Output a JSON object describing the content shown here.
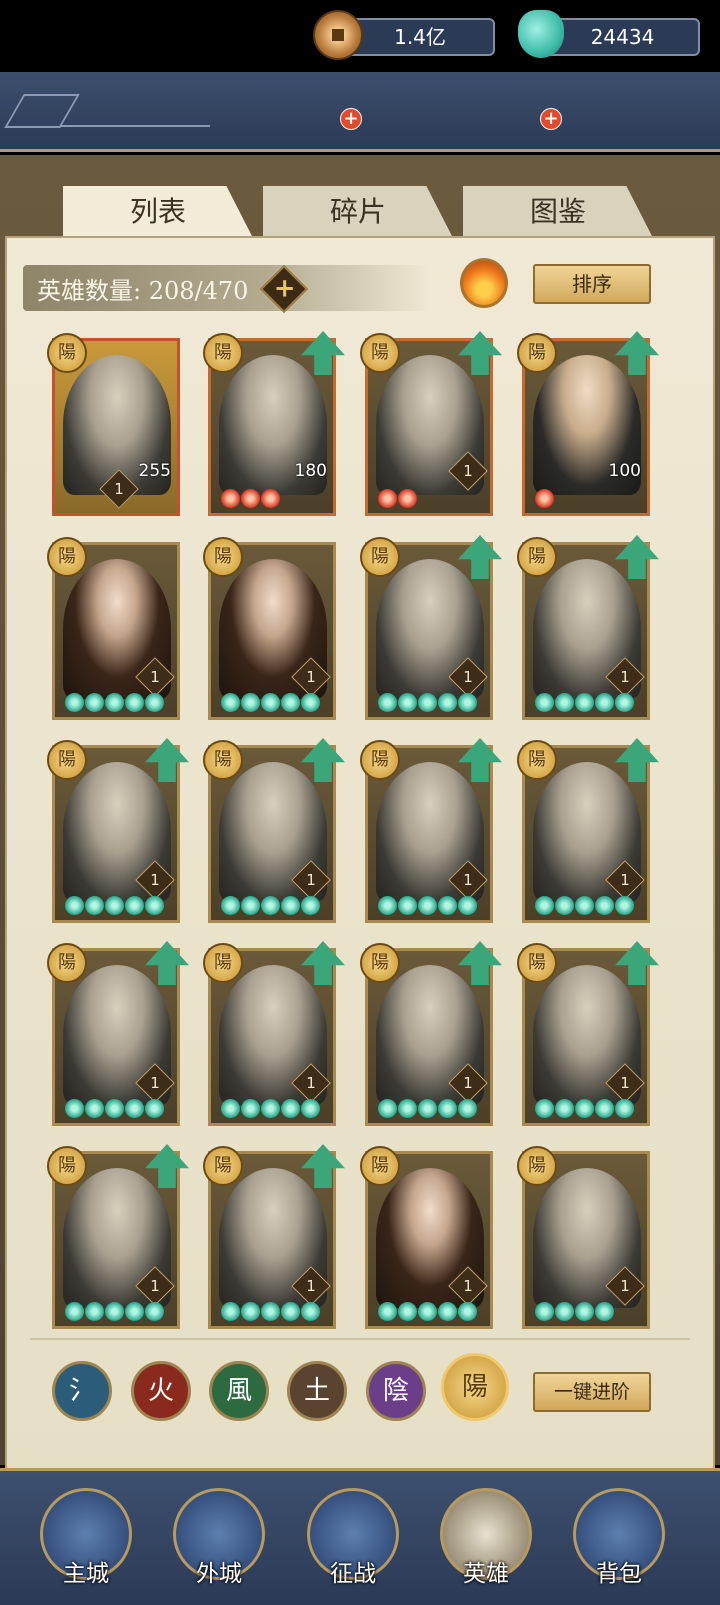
{
  "resources": {
    "coins": "1.4亿",
    "jade": "24434"
  },
  "tabs": [
    "列表",
    "碎片",
    "图鉴"
  ],
  "hero_count_label": "英雄数量: 208/470",
  "sort_label": "排序",
  "advance_all_label": "一键进阶",
  "yang_char": "陽",
  "heroes": [
    {
      "level": "1",
      "stat": "255",
      "gems": 0,
      "gem_color": "none",
      "upgradable": false
    },
    {
      "level": "",
      "stat": "180",
      "gems": 3,
      "gem_color": "red",
      "upgradable": true
    },
    {
      "level": "1",
      "stat": "",
      "gems": 2,
      "gem_color": "red",
      "upgradable": true
    },
    {
      "level": "",
      "stat": "100",
      "gems": 1,
      "gem_color": "red",
      "upgradable": true
    },
    {
      "level": "1",
      "stat": "",
      "gems": 5,
      "gem_color": "green",
      "upgradable": false
    },
    {
      "level": "1",
      "stat": "",
      "gems": 5,
      "gem_color": "green",
      "upgradable": false
    },
    {
      "level": "1",
      "stat": "",
      "gems": 5,
      "gem_color": "green",
      "upgradable": true
    },
    {
      "level": "1",
      "stat": "",
      "gems": 5,
      "gem_color": "green",
      "upgradable": true
    },
    {
      "level": "1",
      "stat": "",
      "gems": 5,
      "gem_color": "green",
      "upgradable": true
    },
    {
      "level": "1",
      "stat": "",
      "gems": 5,
      "gem_color": "green",
      "upgradable": true
    },
    {
      "level": "1",
      "stat": "",
      "gems": 5,
      "gem_color": "green",
      "upgradable": true
    },
    {
      "level": "1",
      "stat": "",
      "gems": 5,
      "gem_color": "green",
      "upgradable": true
    },
    {
      "level": "1",
      "stat": "",
      "gems": 5,
      "gem_color": "green",
      "upgradable": true
    },
    {
      "level": "1",
      "stat": "",
      "gems": 5,
      "gem_color": "green",
      "upgradable": true
    },
    {
      "level": "1",
      "stat": "",
      "gems": 5,
      "gem_color": "green",
      "upgradable": true
    },
    {
      "level": "1",
      "stat": "",
      "gems": 5,
      "gem_color": "green",
      "upgradable": true
    },
    {
      "level": "1",
      "stat": "",
      "gems": 5,
      "gem_color": "green",
      "upgradable": true
    },
    {
      "level": "1",
      "stat": "",
      "gems": 5,
      "gem_color": "green",
      "upgradable": true
    },
    {
      "level": "1",
      "stat": "",
      "gems": 5,
      "gem_color": "green",
      "upgradable": false
    },
    {
      "level": "1",
      "stat": "",
      "gems": 4,
      "gem_color": "green",
      "upgradable": false
    }
  ],
  "element_filters": [
    "氵",
    "火",
    "風",
    "土",
    "陰",
    "陽"
  ],
  "nav": [
    "主城",
    "外城",
    "征战",
    "英雄",
    "背包"
  ]
}
